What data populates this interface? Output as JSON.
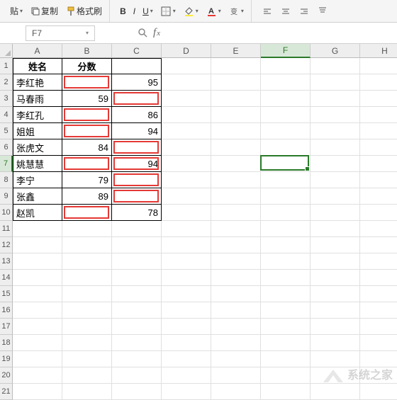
{
  "toolbar": {
    "paste_label": "贴",
    "copy_label": "复制",
    "format_painter_label": "格式刷",
    "bold": "B",
    "italic": "I",
    "underline": "U"
  },
  "namebox": {
    "value": "F7"
  },
  "columns": [
    "A",
    "B",
    "C",
    "D",
    "E",
    "F",
    "G",
    "H"
  ],
  "active": {
    "col": 5,
    "row": 7
  },
  "table": {
    "headers": {
      "name": "姓名",
      "score": "分数"
    },
    "rows": [
      {
        "name": "李红艳",
        "b": "",
        "c": "95"
      },
      {
        "name": "马春雨",
        "b": "59",
        "c": ""
      },
      {
        "name": "李红孔",
        "b": "",
        "c": "86"
      },
      {
        "name": "姐姐",
        "b": "",
        "c": "94"
      },
      {
        "name": "张虎文",
        "b": "84",
        "c": ""
      },
      {
        "name": "姚慧慧",
        "b": "",
        "c": "94"
      },
      {
        "name": "李宁",
        "b": "79",
        "c": ""
      },
      {
        "name": "张鑫",
        "b": "89",
        "c": ""
      },
      {
        "name": "赵凯",
        "b": "",
        "c": "78"
      }
    ]
  },
  "red_highlights": [
    {
      "col": 1,
      "row": 1
    },
    {
      "col": 2,
      "row": 2
    },
    {
      "col": 1,
      "row": 3
    },
    {
      "col": 1,
      "row": 4
    },
    {
      "col": 2,
      "row": 5
    },
    {
      "col": 1,
      "row": 6
    },
    {
      "col": 2,
      "row": 6
    },
    {
      "col": 2,
      "row": 7
    },
    {
      "col": 2,
      "row": 8
    },
    {
      "col": 1,
      "row": 9
    }
  ],
  "watermark": "系统之家",
  "chart_data": {
    "type": "table",
    "title": "",
    "columns": [
      "姓名",
      "分数"
    ],
    "rows": [
      [
        "李红艳",
        95
      ],
      [
        "马春雨",
        59
      ],
      [
        "李红孔",
        86
      ],
      [
        "姐姐",
        94
      ],
      [
        "张虎文",
        84
      ],
      [
        "姚慧慧",
        94
      ],
      [
        "李宁",
        79
      ],
      [
        "张鑫",
        89
      ],
      [
        "赵凯",
        78
      ]
    ]
  }
}
